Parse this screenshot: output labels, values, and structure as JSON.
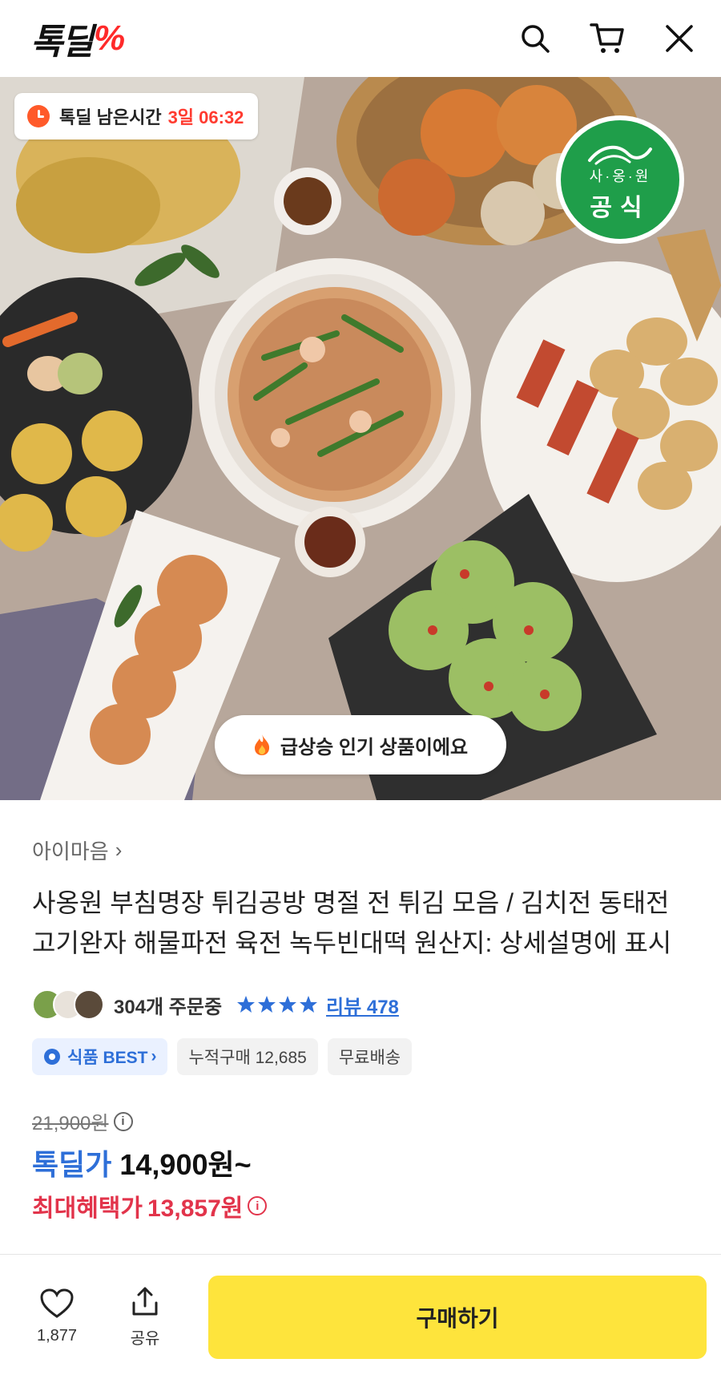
{
  "header": {
    "logo_text": "톡딜",
    "logo_mark": "%",
    "icons": [
      "search-icon",
      "cart-icon",
      "close-icon"
    ]
  },
  "hero": {
    "timer_label": "톡딜 남은시간",
    "timer_value": "3일 06:32",
    "badge_brand": "사·옹·원",
    "badge_official": "공식",
    "hot_label": "급상승 인기 상품이에요"
  },
  "product": {
    "seller": "아이마음",
    "title": "사옹원 부침명장 튀김공방 명절 전 튀김 모음 / 김치전 동태전 고기완자 해물파전 육전 녹두빈대떡 원산지: 상세설명에 표시",
    "orders": "304개 주문중",
    "review": "리뷰 478",
    "chips": {
      "best": "식품 BEST",
      "cumulative": "누적구매 12,685",
      "shipping": "무료배송"
    },
    "original_price": "21,900원",
    "deal_label": "톡딜가",
    "deal_price": "14,900원~",
    "max_label": "최대혜택가",
    "max_price": "13,857원"
  },
  "bottom_bar": {
    "like_count": "1,877",
    "share_label": "공유",
    "buy_label": "구매하기"
  },
  "colors": {
    "accent_blue": "#2e6fd8",
    "accent_red": "#e2344b",
    "buy_yellow": "#fee43c",
    "logo_red": "#ff2a2a",
    "official_green": "#1f9e4a"
  }
}
